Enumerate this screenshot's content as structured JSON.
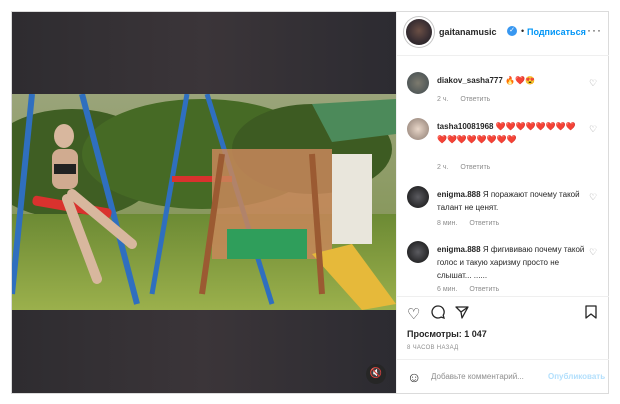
{
  "header": {
    "username": "gaitanamusic",
    "follow_label": "Подписаться",
    "dot": "•",
    "verified_icon": "verified-badge-icon",
    "more_label": "···"
  },
  "comments": [
    {
      "user": "diakov_sasha777",
      "text": "🔥❤️😍",
      "time": "2 ч.",
      "reply": "Ответить"
    },
    {
      "user": "tasha10081968",
      "text": "❤️❤️❤️❤️❤️❤️❤️❤️❤️❤️❤️❤️❤️❤️❤️❤️",
      "time": "2 ч.",
      "reply": "Ответить"
    },
    {
      "user": "enigma.888",
      "text": "Я поражают почему такой талант не ценят.",
      "time": "8 мин.",
      "reply": "Ответить"
    },
    {
      "user": "enigma.888",
      "text": "Я фигививаю почему такой голос и такую харизму просто не слышат... ......",
      "time": "6 мин.",
      "reply": "Ответить"
    }
  ],
  "stats": {
    "views": "Просмотры: 1 047",
    "time_ago": "8 ЧАСОВ НАЗАД"
  },
  "comment_box": {
    "placeholder": "Добавьте комментарий...",
    "publish": "Опубликовать"
  },
  "colors": {
    "accent": "#0095f6",
    "publish_disabled": "#b2dffc",
    "muted": "#8e8e8e",
    "heart_red": "#e0245e"
  }
}
